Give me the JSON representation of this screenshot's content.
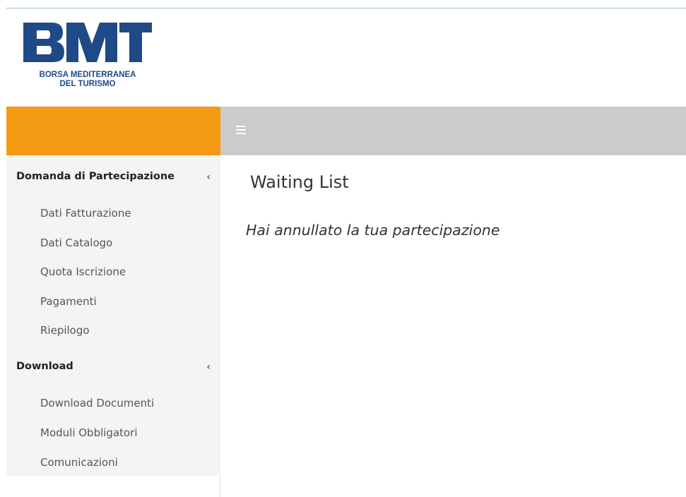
{
  "brand": {
    "logo_text": "BMT",
    "subtitle_line1": "BORSA MEDITERRANEA",
    "subtitle_line2": "DEL TURISMO",
    "color": "#1f4a87"
  },
  "header": {
    "menu_toggle_icon": "hamburger-icon",
    "orange_color": "#f39a12",
    "grey_color": "#cbcbcb"
  },
  "sidebar": {
    "sections": [
      {
        "label": "Domanda di Partecipazione",
        "chevron_icon": "chevron-left-icon",
        "items": [
          {
            "label": "Dati Fatturazione"
          },
          {
            "label": "Dati Catalogo"
          },
          {
            "label": "Quota Iscrizione"
          },
          {
            "label": "Pagamenti"
          },
          {
            "label": "Riepilogo"
          }
        ]
      },
      {
        "label": "Download",
        "chevron_icon": "chevron-left-icon",
        "items": [
          {
            "label": "Download Documenti"
          },
          {
            "label": "Moduli Obbligatori"
          },
          {
            "label": "Comunicazioni"
          }
        ]
      }
    ]
  },
  "main": {
    "title": "Waiting List",
    "message": "Hai annullato la tua partecipazione"
  }
}
